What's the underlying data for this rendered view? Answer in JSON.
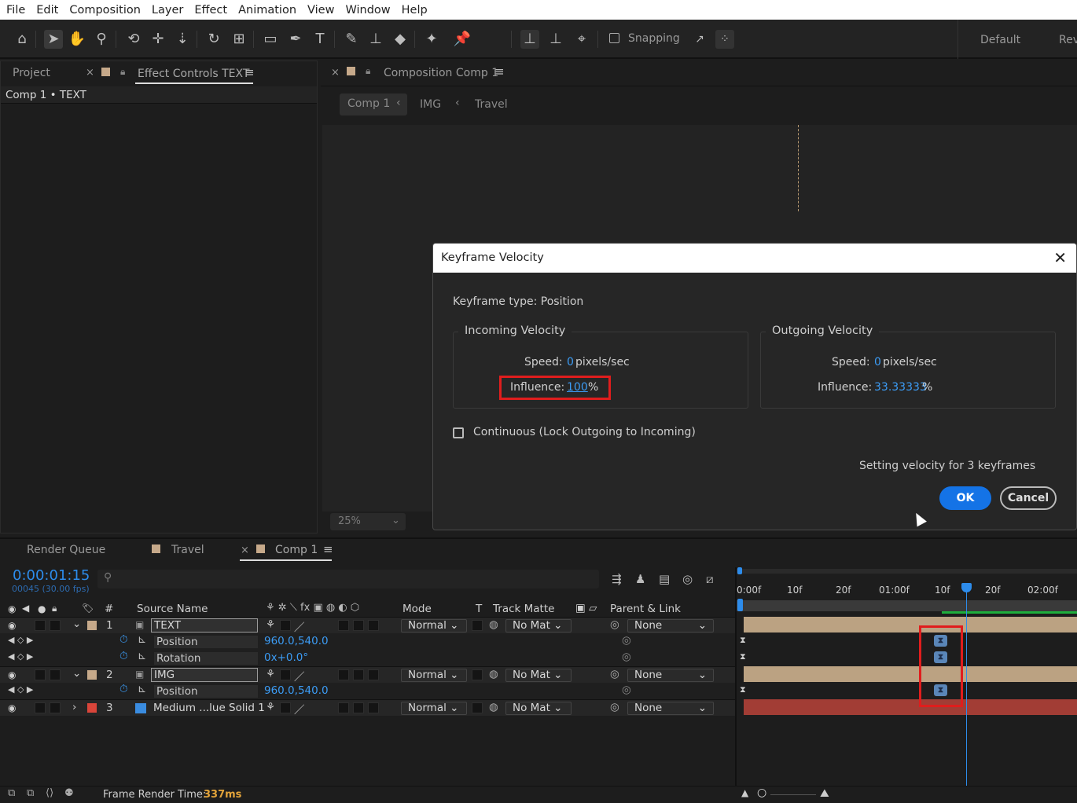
{
  "menu": [
    "File",
    "Edit",
    "Composition",
    "Layer",
    "Effect",
    "Animation",
    "View",
    "Window",
    "Help"
  ],
  "toolbar": {
    "icons": [
      "home-icon",
      "selection-icon",
      "hand-icon",
      "zoom-icon",
      "orbit-icon",
      "pan-icon",
      "dolly-icon",
      "rotate-icon",
      "anchor-icon",
      "rectangle-icon",
      "pen-icon",
      "type-icon",
      "brush-icon",
      "clone-stamp-icon",
      "eraser-icon",
      "roto-brush-icon",
      "puppet-pin-icon"
    ],
    "snapping_label": "Snapping",
    "workspace_default": "Default",
    "workspace_review": "Rev"
  },
  "left_panel": {
    "tab_project": "Project",
    "tab_effect_controls": "Effect Controls TEXT",
    "subtitle": "Comp 1 • TEXT"
  },
  "comp_panel": {
    "tab_label": "Composition Comp 1",
    "breadcrumbs": [
      "Comp 1",
      "IMG",
      "Travel"
    ],
    "zoom": "25%"
  },
  "dialog": {
    "title": "Keyframe Velocity",
    "keyframe_type": "Keyframe type: Position",
    "incoming": {
      "legend": "Incoming Velocity",
      "speed_label": "Speed:",
      "speed_value": "0",
      "speed_unit": "pixels/sec",
      "influence_label": "Influence:",
      "influence_value": "100",
      "influence_unit": "%"
    },
    "outgoing": {
      "legend": "Outgoing Velocity",
      "speed_label": "Speed:",
      "speed_value": "0",
      "speed_unit": "pixels/sec",
      "influence_label": "Influence:",
      "influence_value": "33.33333",
      "influence_unit": "%"
    },
    "continuous_label": "Continuous (Lock Outgoing to Incoming)",
    "status": "Setting velocity for 3 keyframes",
    "ok_label": "OK",
    "cancel_label": "Cancel"
  },
  "timeline": {
    "tabs": [
      "Render Queue",
      "Travel",
      "Comp 1"
    ],
    "timecode": "0:00:01:15",
    "frames": "00045 (30.00 fps)",
    "columns": {
      "number": "#",
      "source_name": "Source Name",
      "mode": "Mode",
      "t": "T",
      "track_matte": "Track Matte",
      "parent_link": "Parent & Link"
    },
    "ruler": [
      "0:00f",
      "10f",
      "20f",
      "01:00f",
      "10f",
      "20f",
      "02:00f"
    ],
    "layers": [
      {
        "index": "1",
        "name": "TEXT",
        "mode": "Normal",
        "matte": "No Mat",
        "parent": "None",
        "label_color": "#c6a98a",
        "props": [
          {
            "name": "Position",
            "value": "960.0,540.0"
          },
          {
            "name": "Rotation",
            "value": "0x+0.0°"
          }
        ]
      },
      {
        "index": "2",
        "name": "IMG",
        "mode": "Normal",
        "matte": "No Mat",
        "parent": "None",
        "label_color": "#c6a98a",
        "props": [
          {
            "name": "Position",
            "value": "960.0,540.0"
          }
        ]
      },
      {
        "index": "3",
        "name": "Medium ...lue Solid 1",
        "mode": "Normal",
        "matte": "No Mat",
        "parent": "None",
        "label_color": "#d9453a"
      }
    ],
    "footer_label": "Frame Render Time:",
    "footer_value": "337ms"
  },
  "colors": {
    "accent_blue": "#1473e6",
    "value_blue": "#3c9cf5",
    "highlight_red": "#e01d1d",
    "layer_tan": "#c6a98a",
    "solid_red": "#d9453a"
  }
}
